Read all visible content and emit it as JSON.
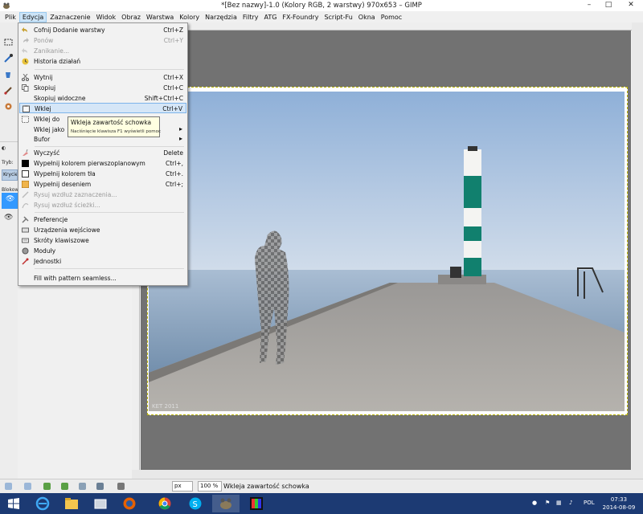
{
  "window": {
    "title": "*[Bez nazwy]-1.0 (Kolory RGB, 2 warstwy) 970x653 – GIMP",
    "minimize": "–",
    "maximize": "□",
    "close": "✕"
  },
  "menubar": [
    "Plik",
    "Edycja",
    "Zaznaczenie",
    "Widok",
    "Obraz",
    "Warstwa",
    "Kolory",
    "Narzędzia",
    "Filtry",
    "ATG",
    "FX-Foundry",
    "Script-Fu",
    "Okna",
    "Pomoc"
  ],
  "edit_menu": [
    {
      "label": "Cofnij Dodanie warstwy",
      "shortcut": "Ctrl+Z",
      "icon": "undo-icon",
      "disabled": false
    },
    {
      "label": "Ponów",
      "shortcut": "Ctrl+Y",
      "icon": "redo-icon",
      "disabled": true
    },
    {
      "label": "Zanikanie...",
      "shortcut": "",
      "icon": "fade-icon",
      "disabled": true
    },
    {
      "label": "Historia działań",
      "shortcut": "",
      "icon": "history-icon",
      "disabled": false
    },
    {
      "label": "Wytnij",
      "shortcut": "Ctrl+X",
      "icon": "cut-icon",
      "disabled": false
    },
    {
      "label": "Skopiuj",
      "shortcut": "Ctrl+C",
      "icon": "copy-icon",
      "disabled": false
    },
    {
      "label": "Skopiuj widoczne",
      "shortcut": "Shift+Ctrl+C",
      "icon": "",
      "disabled": false
    },
    {
      "label": "Wklej",
      "shortcut": "Ctrl+V",
      "icon": "paste-icon",
      "disabled": false
    },
    {
      "label": "Wklej do",
      "shortcut": "",
      "icon": "paste-into-icon",
      "disabled": false
    },
    {
      "label": "Wklej jako",
      "shortcut": "",
      "icon": "",
      "disabled": false,
      "submenu": true
    },
    {
      "label": "Bufor",
      "shortcut": "",
      "icon": "",
      "disabled": false,
      "submenu": true
    },
    {
      "label": "Wyczyść",
      "shortcut": "Delete",
      "icon": "clear-icon",
      "disabled": false
    },
    {
      "label": "Wypełnij kolorem pierwszoplanowym",
      "shortcut": "Ctrl+,",
      "icon": "fill-fg-icon",
      "disabled": false
    },
    {
      "label": "Wypełnij kolorem tła",
      "shortcut": "Ctrl+.",
      "icon": "fill-bg-icon",
      "disabled": false
    },
    {
      "label": "Wypełnij deseniem",
      "shortcut": "Ctrl+;",
      "icon": "fill-pattern-icon",
      "disabled": false
    },
    {
      "label": "Rysuj wzdłuż zaznaczenia...",
      "shortcut": "",
      "icon": "stroke-selection-icon",
      "disabled": true
    },
    {
      "label": "Rysuj wzdłuż ścieżki...",
      "shortcut": "",
      "icon": "stroke-path-icon",
      "disabled": true
    },
    {
      "label": "Preferencje",
      "shortcut": "",
      "icon": "preferences-icon",
      "disabled": false
    },
    {
      "label": "Urządzenia wejściowe",
      "shortcut": "",
      "icon": "input-devices-icon",
      "disabled": false
    },
    {
      "label": "Skróty klawiszowe",
      "shortcut": "",
      "icon": "keyboard-icon",
      "disabled": false
    },
    {
      "label": "Moduły",
      "shortcut": "",
      "icon": "modules-icon",
      "disabled": false
    },
    {
      "label": "Jednostki",
      "shortcut": "",
      "icon": "units-icon",
      "disabled": false
    },
    {
      "label": "Fill with pattern seamless...",
      "shortcut": "",
      "icon": "",
      "disabled": false
    }
  ],
  "highlighted_item": "Wklej",
  "tooltip": {
    "title": "Wkleja zawartość schowka",
    "hint": "Naciśnięcie klawisza F1 wyświetli pomoc"
  },
  "dock": {
    "mode_label": "Tryb:",
    "opacity_label": "Krycie",
    "lock_label": "Blokow"
  },
  "statusbar": {
    "unit": "px",
    "zoom": "100 %",
    "message": "Wkleja zawartość schowka"
  },
  "image": {
    "watermark": "KET 2011"
  },
  "taskbar": {
    "language": "POL",
    "time": "07:33",
    "date": "2014-08-09"
  },
  "colors": {
    "taskbar": "#1c3a73",
    "menu_highlight": "#d5e6f7",
    "canvas_bg": "#727272",
    "lighthouse_green": "#11806e"
  }
}
